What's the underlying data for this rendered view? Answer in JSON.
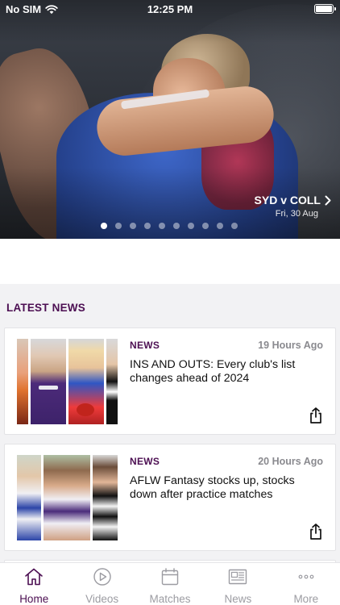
{
  "status_bar": {
    "carrier": "No SIM",
    "time": "12:25 PM"
  },
  "hero": {
    "match": "SYD v COLL",
    "date": "Fri, 30 Aug",
    "slide_count": 10,
    "active_slide": 0
  },
  "news": {
    "heading": "LATEST NEWS",
    "articles": [
      {
        "tag": "NEWS",
        "age": "19 Hours Ago",
        "title": "INS AND OUTS: Every club's list changes ahead of 2024"
      },
      {
        "tag": "NEWS",
        "age": "20 Hours Ago",
        "title": "AFLW Fantasy stocks up, stocks down after practice matches"
      }
    ]
  },
  "tabbar": {
    "tabs": [
      {
        "label": "Home",
        "icon": "home-icon",
        "active": true
      },
      {
        "label": "Videos",
        "icon": "play-icon",
        "active": false
      },
      {
        "label": "Matches",
        "icon": "calendar-icon",
        "active": false
      },
      {
        "label": "News",
        "icon": "newspaper-icon",
        "active": false
      },
      {
        "label": "More",
        "icon": "more-icon",
        "active": false
      }
    ]
  },
  "colors": {
    "brand": "#4c0f52",
    "inactive": "#9c9ca2",
    "section_bg": "#f2f2f4"
  }
}
